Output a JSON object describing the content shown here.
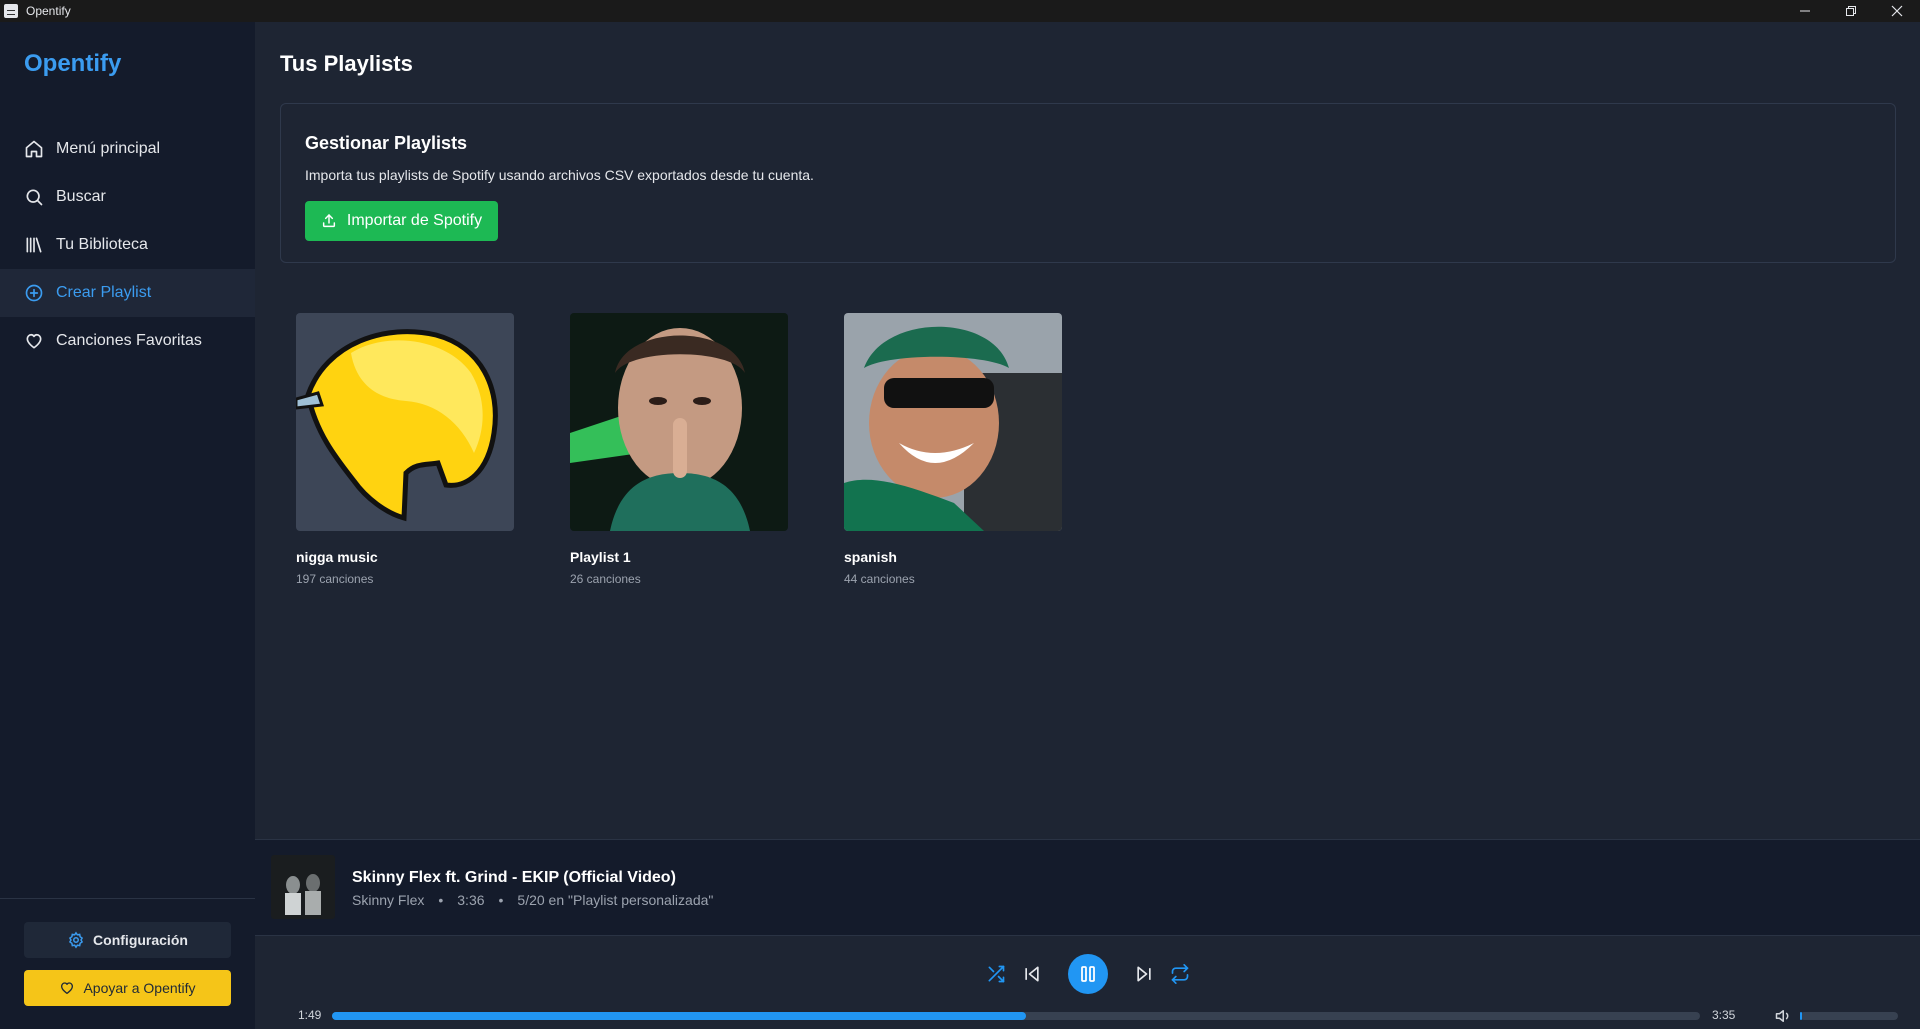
{
  "window": {
    "title": "Opentify",
    "controls": [
      "minimize-icon",
      "restore-icon",
      "close-icon"
    ]
  },
  "sidebar": {
    "brand": "Opentify",
    "items": [
      {
        "label": "Menú principal",
        "icon": "home-icon",
        "active": false
      },
      {
        "label": "Buscar",
        "icon": "search-icon",
        "active": false
      },
      {
        "label": "Tu Biblioteca",
        "icon": "library-icon",
        "active": false
      },
      {
        "label": "Crear Playlist",
        "icon": "plus-circle-icon",
        "active": true
      },
      {
        "label": "Canciones Favoritas",
        "icon": "heart-icon",
        "active": false
      }
    ],
    "config_label": "Configuración",
    "support_label": "Apoyar a Opentify"
  },
  "main": {
    "title": "Tus Playlists",
    "manage": {
      "title": "Gestionar Playlists",
      "description": "Importa tus playlists de Spotify usando archivos CSV exportados desde tu cuenta.",
      "import_label": "Importar de Spotify"
    },
    "playlists": [
      {
        "name": "nigga music",
        "count": "197 canciones"
      },
      {
        "name": "Playlist 1",
        "count": "26 canciones"
      },
      {
        "name": "spanish",
        "count": "44 canciones"
      }
    ]
  },
  "now_playing": {
    "title": "Skinny Flex ft. Grind - EKIP (Official Video)",
    "artist": "Skinny Flex",
    "duration": "3:36",
    "position": "5/20 en \"Playlist personalizada\"",
    "dot": "•"
  },
  "player": {
    "elapsed": "1:49",
    "total": "3:35",
    "progress_fraction": 0.507,
    "volume_fraction": 0.02
  },
  "colors": {
    "accent": "#2196f3",
    "brand": "#3b9cf0",
    "import": "#1db954",
    "support": "#f5c518"
  }
}
